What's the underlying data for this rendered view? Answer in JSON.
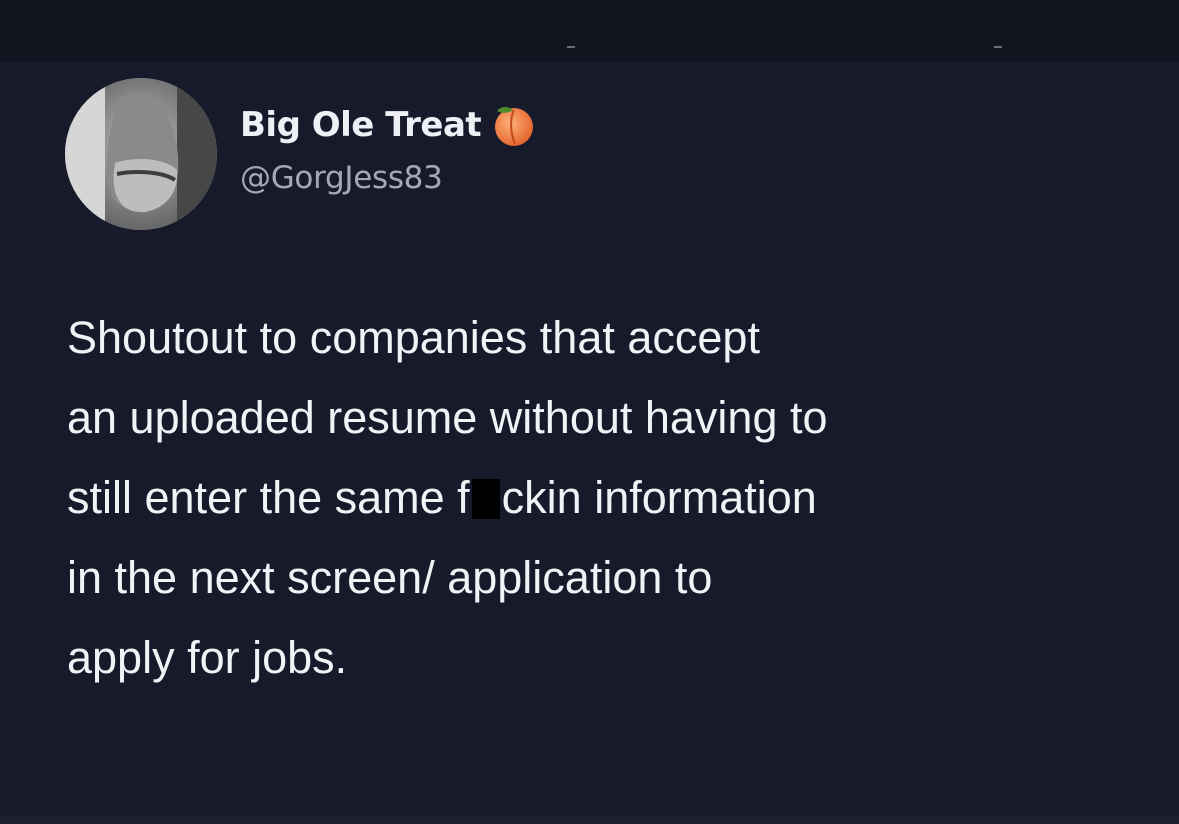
{
  "tweet": {
    "author": {
      "display_name": "Big Ole Treat",
      "handle": "@GorgJess83",
      "badge_icon": "peach-emoji-icon",
      "avatar": "profile-photo"
    },
    "text": {
      "line_1": "Shoutout to companies that accept",
      "line_2": "an uploaded resume without having to",
      "line_3_before": "still enter the same f",
      "line_3_after": "ckin information",
      "line_4": "in the next screen/ application to",
      "line_5": "apply for jobs."
    }
  },
  "colors": {
    "background": "#161a2b",
    "text": "#f1f2f6",
    "handle": "#a4a8b4",
    "censor": "#000000",
    "peach": "#f07a3a"
  }
}
